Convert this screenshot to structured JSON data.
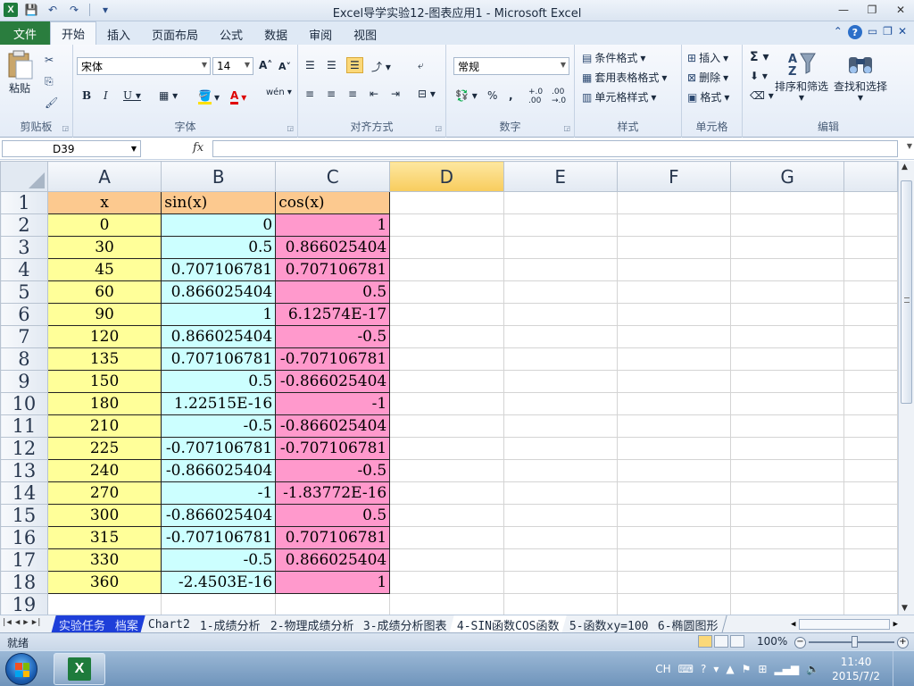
{
  "window": {
    "title": "Excel导学实验12-图表应用1 - Microsoft Excel",
    "controls": {
      "minimize": "—",
      "maximize": "❐",
      "close": "✕"
    }
  },
  "qat": {
    "save": "💾",
    "undo": "↶",
    "redo": "↷",
    "customize": "▾"
  },
  "ribbon": {
    "file_tab": "文件",
    "tabs": [
      "开始",
      "插入",
      "页面布局",
      "公式",
      "数据",
      "审阅",
      "视图"
    ],
    "active_tab": "开始",
    "groups": {
      "clipboard": {
        "label": "剪贴板",
        "paste": "粘贴"
      },
      "font": {
        "label": "字体",
        "font_name": "宋体",
        "font_size": "14"
      },
      "alignment": {
        "label": "对齐方式"
      },
      "number": {
        "label": "数字",
        "format": "常规"
      },
      "styles": {
        "label": "样式",
        "conditional": "条件格式",
        "table": "套用表格格式",
        "cell_styles": "单元格样式"
      },
      "cells": {
        "label": "单元格",
        "insert": "插入",
        "delete": "删除",
        "format": "格式"
      },
      "editing": {
        "label": "编辑",
        "sort_filter": "排序和筛选",
        "find_select": "查找和选择"
      }
    }
  },
  "formula_bar": {
    "name_box": "D39",
    "fx": "fx",
    "formula": ""
  },
  "sheet": {
    "columns": [
      "A",
      "B",
      "C",
      "D",
      "E",
      "F",
      "G"
    ],
    "selected_column": "D",
    "header_row": [
      "x",
      "sin(x)",
      "cos(x)"
    ],
    "rows": [
      [
        "0",
        "0",
        "1"
      ],
      [
        "30",
        "0.5",
        "0.866025404"
      ],
      [
        "45",
        "0.707106781",
        "0.707106781"
      ],
      [
        "60",
        "0.866025404",
        "0.5"
      ],
      [
        "90",
        "1",
        "6.12574E-17"
      ],
      [
        "120",
        "0.866025404",
        "-0.5"
      ],
      [
        "135",
        "0.707106781",
        "-0.707106781"
      ],
      [
        "150",
        "0.5",
        "-0.866025404"
      ],
      [
        "180",
        "1.22515E-16",
        "-1"
      ],
      [
        "210",
        "-0.5",
        "-0.866025404"
      ],
      [
        "225",
        "-0.707106781",
        "-0.707106781"
      ],
      [
        "240",
        "-0.866025404",
        "-0.5"
      ],
      [
        "270",
        "-1",
        "-1.83772E-16"
      ],
      [
        "300",
        "-0.866025404",
        "0.5"
      ],
      [
        "315",
        "-0.707106781",
        "0.707106781"
      ],
      [
        "330",
        "-0.5",
        "0.866025404"
      ],
      [
        "360",
        "-2.4503E-16",
        "1"
      ]
    ],
    "row_numbers": [
      "1",
      "2",
      "3",
      "4",
      "5",
      "6",
      "7",
      "8",
      "9",
      "10",
      "11",
      "12",
      "13",
      "14",
      "15",
      "16",
      "17",
      "18",
      "19"
    ]
  },
  "sheet_tabs": [
    {
      "label": "实验任务",
      "style": "blue"
    },
    {
      "label": "档案",
      "style": "blue"
    },
    {
      "label": "Chart2",
      "style": "normal"
    },
    {
      "label": "1-成绩分析",
      "style": "normal"
    },
    {
      "label": "2-物理成绩分析",
      "style": "normal"
    },
    {
      "label": "3-成绩分析图表",
      "style": "normal"
    },
    {
      "label": "4-SIN函数COS函数",
      "style": "active"
    },
    {
      "label": "5-函数xy=100",
      "style": "normal"
    },
    {
      "label": "6-椭圆图形",
      "style": "normal"
    }
  ],
  "status": {
    "ready": "就绪",
    "zoom": "100%"
  },
  "taskbar": {
    "language": "CH",
    "time": "11:40",
    "date": "2015/7/2"
  },
  "colors": {
    "header_fill": "#fcc98f",
    "x_fill": "#ffff99",
    "sin_fill": "#ccffff",
    "cos_fill": "#ff99cc",
    "file_tab": "#2a7d3e"
  }
}
